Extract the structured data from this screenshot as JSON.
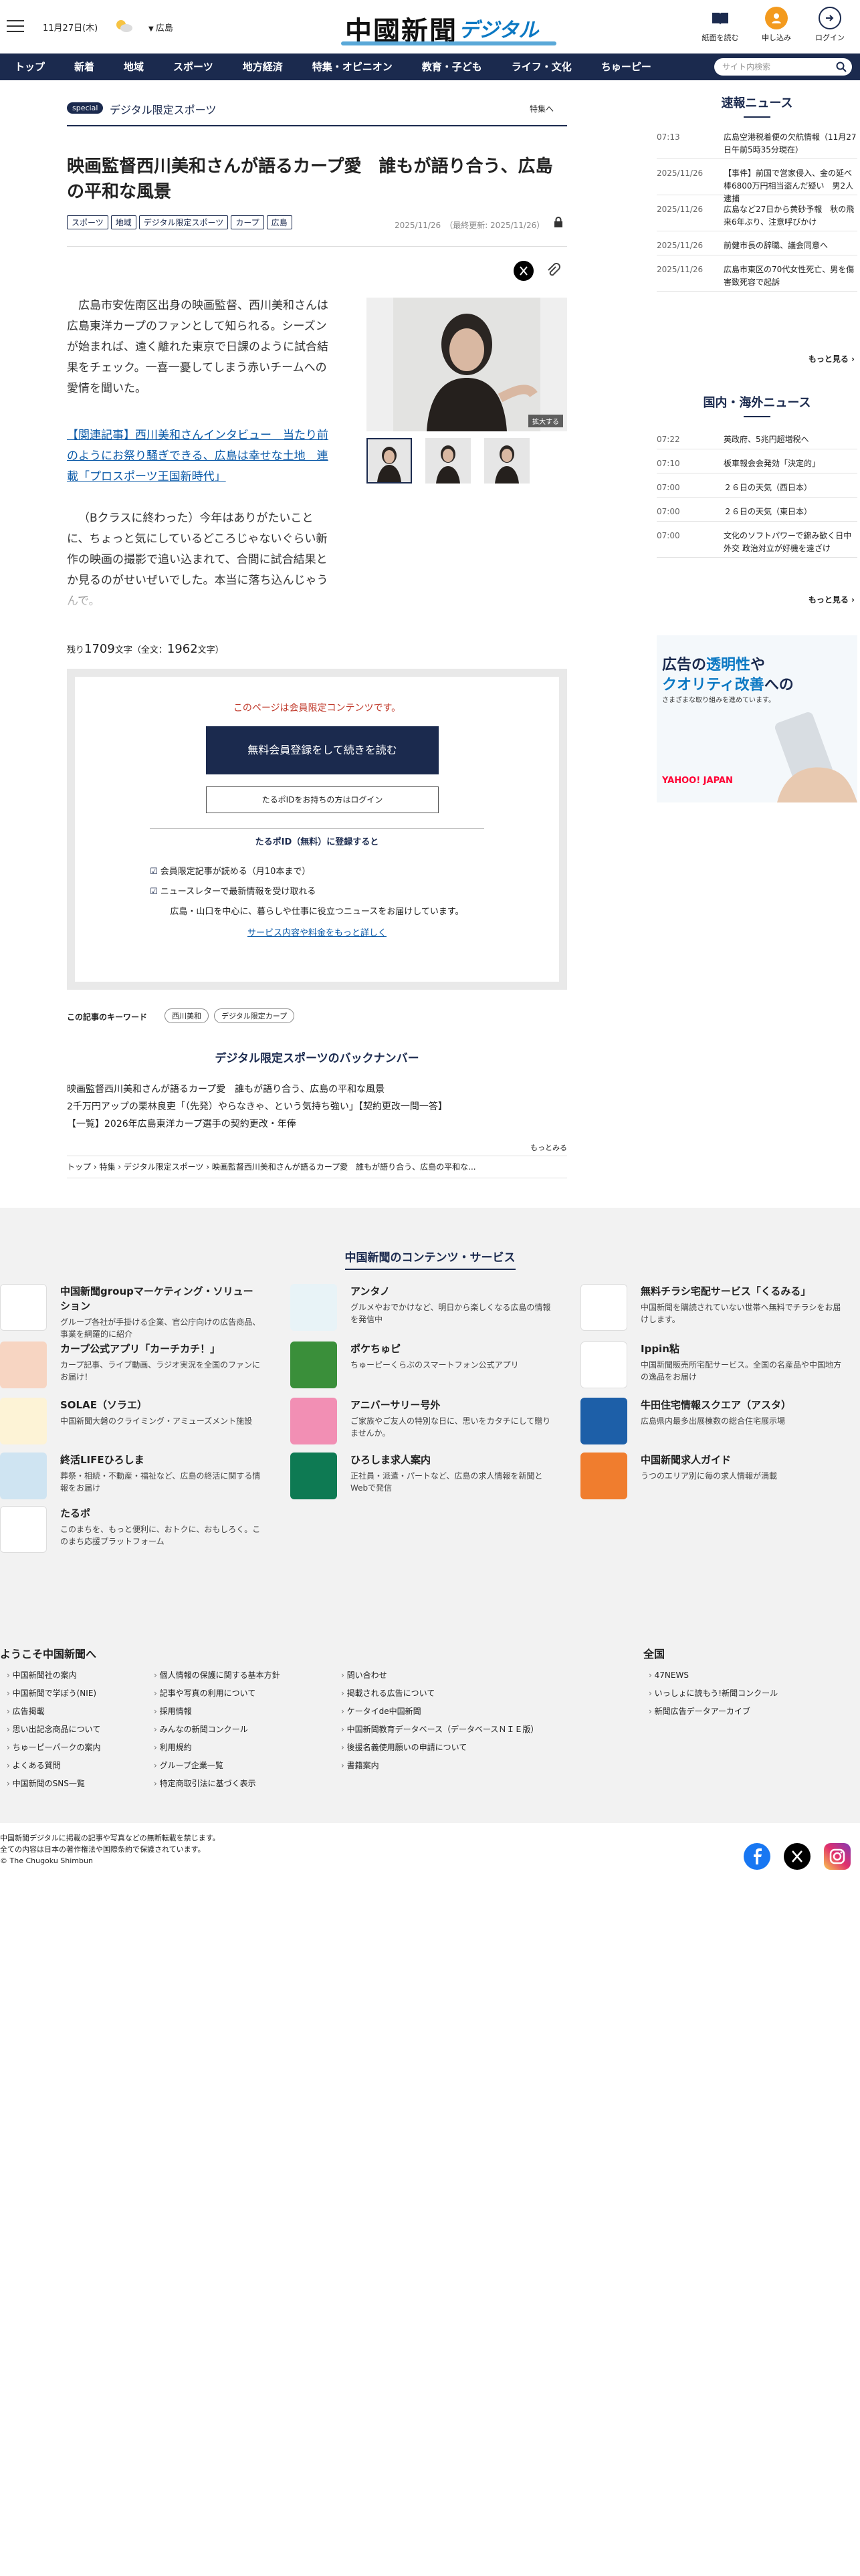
{
  "header": {
    "date": "11月27日(木)",
    "location": "広島",
    "logo_main": "中國新聞",
    "logo_sub": "デジタル",
    "btn_paper": "紙面を読む",
    "btn_apply": "申し込み",
    "btn_login": "ログイン",
    "colors": {
      "navy": "#1b2a4e",
      "accent_orange": "#f39a1e",
      "link_blue": "#0b5aa8"
    }
  },
  "nav": {
    "items": [
      "トップ",
      "新着",
      "地域",
      "スポーツ",
      "地方経済",
      "特集・オピニオン",
      "教育・子ども",
      "ライフ・文化",
      "ちゅーピー"
    ],
    "search_placeholder": "サイト内検索"
  },
  "article": {
    "special_tag": "special",
    "special_label": "デジタル限定スポーツ",
    "special_link": "特集へ",
    "title": "映画監督西川美和さんが語るカープ愛　誰もが語り合う、広島の平和な風景",
    "tags": [
      "スポーツ",
      "地域",
      "デジタル限定スポーツ",
      "カープ",
      "広島"
    ],
    "date": "2025/11/26",
    "updated": "（最終更新: 2025/11/26）",
    "para1": "広島市安佐南区出身の映画監督、西川美和さんは広島東洋カープのファンとして知られる。シーズンが始まれば、遠く離れた東京で日課のように試合結果をチェック。一喜一憂してしまう赤いチームへの愛情を聞いた。",
    "related": "【関連記事】西川美和さんインタビュー　当たり前のようにお祭り騒ぎできる、広島は幸せな土地　連載「プロスポーツ王国新時代」",
    "para2": "（Bクラスに終わった）今年はありがたいことに、ちょっと気にしているどころじゃないぐらい新作の映画の撮影で追い込まれて、合間に試合結果とか見るのがせいぜいでした。本当に落ち込んじゃうんで。",
    "enlarge": "拡大する",
    "remain_prefix": "残り",
    "remain_count": "1709",
    "remain_mid": "文字（全文：",
    "total_count": "1962",
    "remain_suffix": "文字）"
  },
  "paywall": {
    "notice": "このページは会員限定コンテンツです。",
    "register": "無料会員登録をして続きを読む",
    "login": "たるポIDをお持ちの方はログイン",
    "heading": "たるポID（無料）に登録すると",
    "benefit1": "会員限定記事が読める（月10本まで）",
    "benefit2": "ニュースレターで最新情報を受け取れる",
    "benefit3": "広島・山口を中心に、暮らしや仕事に役立つニュースをお届けしています。",
    "details": "サービス内容や料金をもっと詳しく"
  },
  "keywords": {
    "label": "この記事のキーワード",
    "items": [
      "西川美和",
      "デジタル限定カープ"
    ]
  },
  "backnumber": {
    "heading": "デジタル限定スポーツのバックナンバー",
    "items": [
      "映画監督西川美和さんが語るカープ愛　誰もが語り合う、広島の平和な風景",
      "2千万円アップの栗林良吏「（先発）やらなきゃ、という気持ち強い」【契約更改一問一答】",
      "【一覧】2026年広島東洋カープ選手の契約更改・年俸"
    ],
    "more": "もっとみる"
  },
  "breadcrumb": [
    "トップ",
    "特集",
    "デジタル限定スポーツ",
    "映画監督西川美和さんが語るカープ愛　誰もが語り合う、広島の平和な..."
  ],
  "sidebar": {
    "breaking_title": "速報ニュース",
    "breaking": [
      {
        "time": "07:13",
        "text": "広島空港税着便の欠航情報（11月27日午前5時35分現在）"
      },
      {
        "time": "2025/11/26",
        "text": "【事件】前国で営家侵入、金の延べ棒6800万円相当盗んだ疑い　男2人逮捕"
      },
      {
        "time": "2025/11/26",
        "text": "広島など27日から黄砂予報　秋の飛来6年ぶり、注意呼びかけ"
      },
      {
        "time": "2025/11/26",
        "text": "前健市長の辞職、議会同意へ"
      },
      {
        "time": "2025/11/26",
        "text": "広島市東区の70代女性死亡、男を傷害致死容で起訴"
      }
    ],
    "breaking_more": "もっと見る",
    "world_title": "国内・海外ニュース",
    "world": [
      {
        "time": "07:22",
        "text": "英政府、5兆円超増税へ"
      },
      {
        "time": "07:10",
        "text": "板車報会会発効「決定的」"
      },
      {
        "time": "07:00",
        "text": "２６日の天気（西日本）"
      },
      {
        "time": "07:00",
        "text": "２６日の天気（東日本）"
      },
      {
        "time": "07:00",
        "text": "文化のソフトパワーで錦み歓く日中外交 政治対立が好機を遠ざけ"
      }
    ],
    "world_more": "もっと見る",
    "ad_line1a": "広告の",
    "ad_line1b": "透明性",
    "ad_line1c": "や",
    "ad_line2a": "クオリティ改善",
    "ad_line2b": "への",
    "ad_line3": "さまざまな取り組みを進めています。",
    "ad_brand": "YAHOO! JAPAN"
  },
  "services": {
    "heading": "中国新聞のコンテンツ・サービス",
    "items": [
      {
        "name": "中国新聞groupマーケティング・ソリューション",
        "desc": "グループ各社が手掛ける企業、官公庁向けの広告商品、事業を網羅的に紹介"
      },
      {
        "name": "アンタノ",
        "desc": "グルメやおでかけなど、明日から楽しくなる広島の情報を発信中"
      },
      {
        "name": "無料チラシ宅配サービス「くるみる」",
        "desc": "中国新聞を購読されていない世帯へ無料でチラシをお届けします。"
      },
      {
        "name": "カープ公式アプリ「カーチカチ！」",
        "desc": "カープ記事、ライブ動画、ラジオ実況を全国のファンにお届け！"
      },
      {
        "name": "ポケちゅピ",
        "desc": "ちゅーピーくらぶのスマートフォン公式アプリ"
      },
      {
        "name": "Ippin粘",
        "desc": "中国新聞販売所宅配サービス。全国の名産品や中国地方の逸品をお届け"
      },
      {
        "name": "SOLAE（ソラエ）",
        "desc": "中国新聞大磐のクライミング・アミューズメント施設"
      },
      {
        "name": "アニバーサリー号外",
        "desc": "ご家族やご友人の特別な日に、思いをカタチにして贈りませんか。"
      },
      {
        "name": "牛田住宅情報スクエア（アスタ）",
        "desc": "広島県内最多出展棟数の総合住宅展示場"
      },
      {
        "name": "終活LIFEひろしま",
        "desc": "葬祭・相続・不動産・福祉など、広島の終活に関する情報をお届け"
      },
      {
        "name": "ひろしま求人案内",
        "desc": "正社員・派遣・パートなど、広島の求人情報を新聞とWebで発信"
      },
      {
        "name": "中国新聞求人ガイド",
        "desc": "うつのエリア別に毎の求人情報が満載"
      },
      {
        "name": "たるポ",
        "desc": "このまちを、もっと便利に、おトクに、おもしろく。このまち応援プラットフォーム"
      }
    ]
  },
  "footer": {
    "welcome_title": "ようこそ中国新聞へ",
    "col1": [
      "中国新聞社の案内",
      "中国新聞で学ぼう(NIE)",
      "広告掲載",
      "思い出記念商品について",
      "ちゅーピーパークの案内",
      "よくある質問",
      "中国新聞のSNS一覧"
    ],
    "col2": [
      "個人情報の保護に関する基本方針",
      "記事や写真の利用について",
      "採用情報",
      "みんなの新聞コンクール",
      "利用規約",
      "グループ企業一覧",
      "特定商取引法に基づく表示"
    ],
    "col3": [
      "問い合わせ",
      "掲載される広告について",
      "ケータイde中国新聞",
      "中国新聞教育データベース（データベースＮＩＥ版）",
      "後援名義使用願いの申請について",
      "書籍案内"
    ],
    "national_title": "全国",
    "col4": [
      "47NEWS",
      "いっしょに読もう!新聞コンクール",
      "新聞広告データアーカイブ"
    ],
    "copy1": "中国新聞デジタルに掲載の記事や写真などの無断転載を禁じます。",
    "copy2": "全ての内容は日本の著作権法や国際条約で保護されています。",
    "copy3": "© The Chugoku Shimbun"
  }
}
